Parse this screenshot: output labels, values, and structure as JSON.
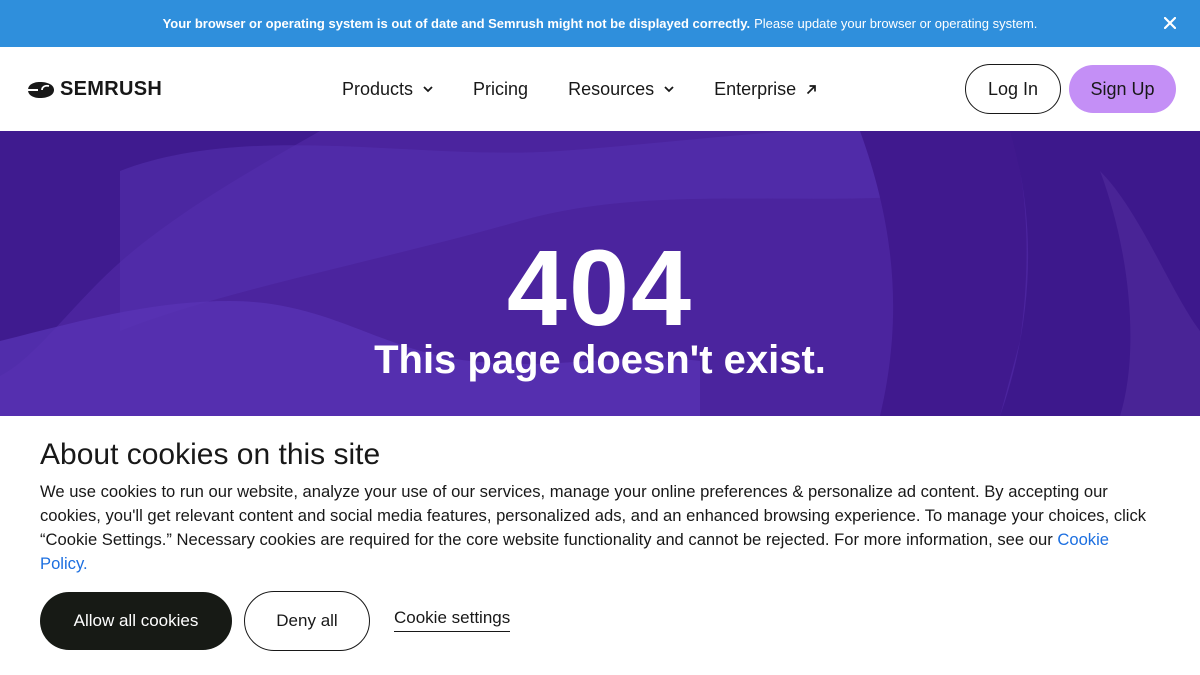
{
  "banner": {
    "bold_text": "Your browser or operating system is out of date and Semrush might not be displayed correctly.",
    "text": "Please update your browser or operating system.",
    "close_icon": "close-icon",
    "bg_color": "#2f8fdc"
  },
  "header": {
    "logo_text": "SEMRUSH",
    "nav": [
      {
        "label": "Products",
        "icon": "chevron-down-icon"
      },
      {
        "label": "Pricing"
      },
      {
        "label": "Resources",
        "icon": "chevron-down-icon"
      },
      {
        "label": "Enterprise",
        "icon": "external-arrow-icon"
      }
    ],
    "login_label": "Log In",
    "signup_label": "Sign Up",
    "signup_color": "#c48ff6"
  },
  "hero": {
    "code": "404",
    "message": "This page doesn't exist.",
    "bg_color": "#4b249e"
  },
  "cookie": {
    "title": "About cookies on this site",
    "body": "We use cookies to run our website, analyze your use of our services, manage your online preferences & personalize ad content. By accepting our cookies, you'll get relevant content and social media features, personalized ads, and an enhanced browsing experience. To manage your choices, click “Cookie Settings.” Necessary cookies are required for the core website functionality and cannot be rejected. For more information, see our",
    "policy_link": "Cookie Policy.",
    "allow_label": "Allow all cookies",
    "deny_label": "Deny all",
    "settings_label": "Cookie settings",
    "link_color": "#1c6fe0"
  }
}
